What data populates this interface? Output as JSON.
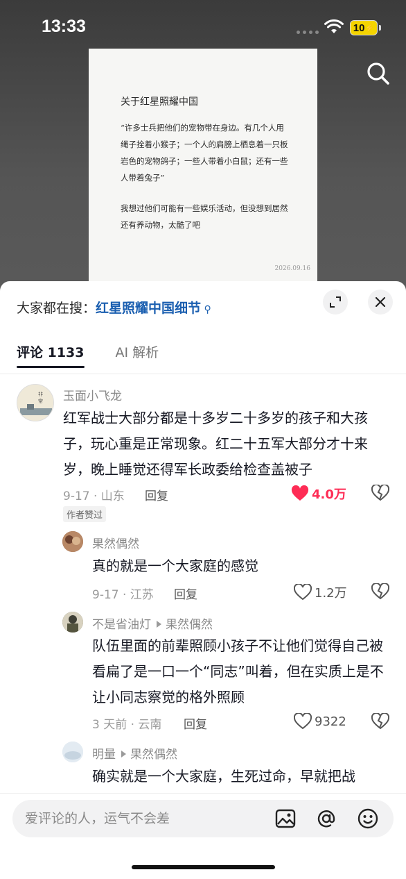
{
  "status": {
    "time": "13:33",
    "battery": "10"
  },
  "paper": {
    "title": "关于红星照耀中国",
    "quote": "“许多士兵把他们的宠物带在身边。有几个人用绳子拴着小猴子；一个人的肩膀上栖息着一只板岩色的宠物鸽子；一些人带着小白鼠；还有一些人带着兔子”",
    "note": "我想过他们可能有一些娱乐活动，但没想到居然还有养动物，太酷了吧",
    "date": "2026.09.16"
  },
  "sheet": {
    "search_prefix": "大家都在搜：",
    "search_keyword": "红星照耀中国细节",
    "tabs": [
      {
        "label": "评论 1133"
      },
      {
        "label": "AI 解析"
      }
    ]
  },
  "comments": [
    {
      "user": "玉面小飞龙",
      "text": "红军战士大部分都是十多岁二十多岁的孩子和大孩子，玩心重是正常现象。红二十五军大部分才十来岁，晚上睡觉还得军长政委给检查盖被子",
      "meta": "9-17 · 山东",
      "reply": "回复",
      "likes": "4.0万",
      "badge": "作者赞过"
    },
    {
      "user": "果然偶然",
      "text": "真的就是一个大家庭的感觉",
      "meta": "9-17 · 江苏",
      "reply": "回复",
      "likes": "1.2万"
    },
    {
      "user": "不是省油灯",
      "reply_to": "果然偶然",
      "text": "队伍里面的前辈照顾小孩子不让他们觉得自己被看扁了是一口一个“同志”叫着，但在实质上是不让小同志察觉的格外照顾",
      "meta": "3 天前 · 云南",
      "reply": "回复",
      "likes": "9322"
    },
    {
      "user": "明量",
      "reply_to": "果然偶然",
      "text": "确实就是一个大家庭，生死过命，早就把战"
    }
  ],
  "input": {
    "placeholder": "爱评论的人，运气不会差"
  },
  "colors": {
    "accent": "#fe2c55",
    "link": "#1b5fb0"
  }
}
